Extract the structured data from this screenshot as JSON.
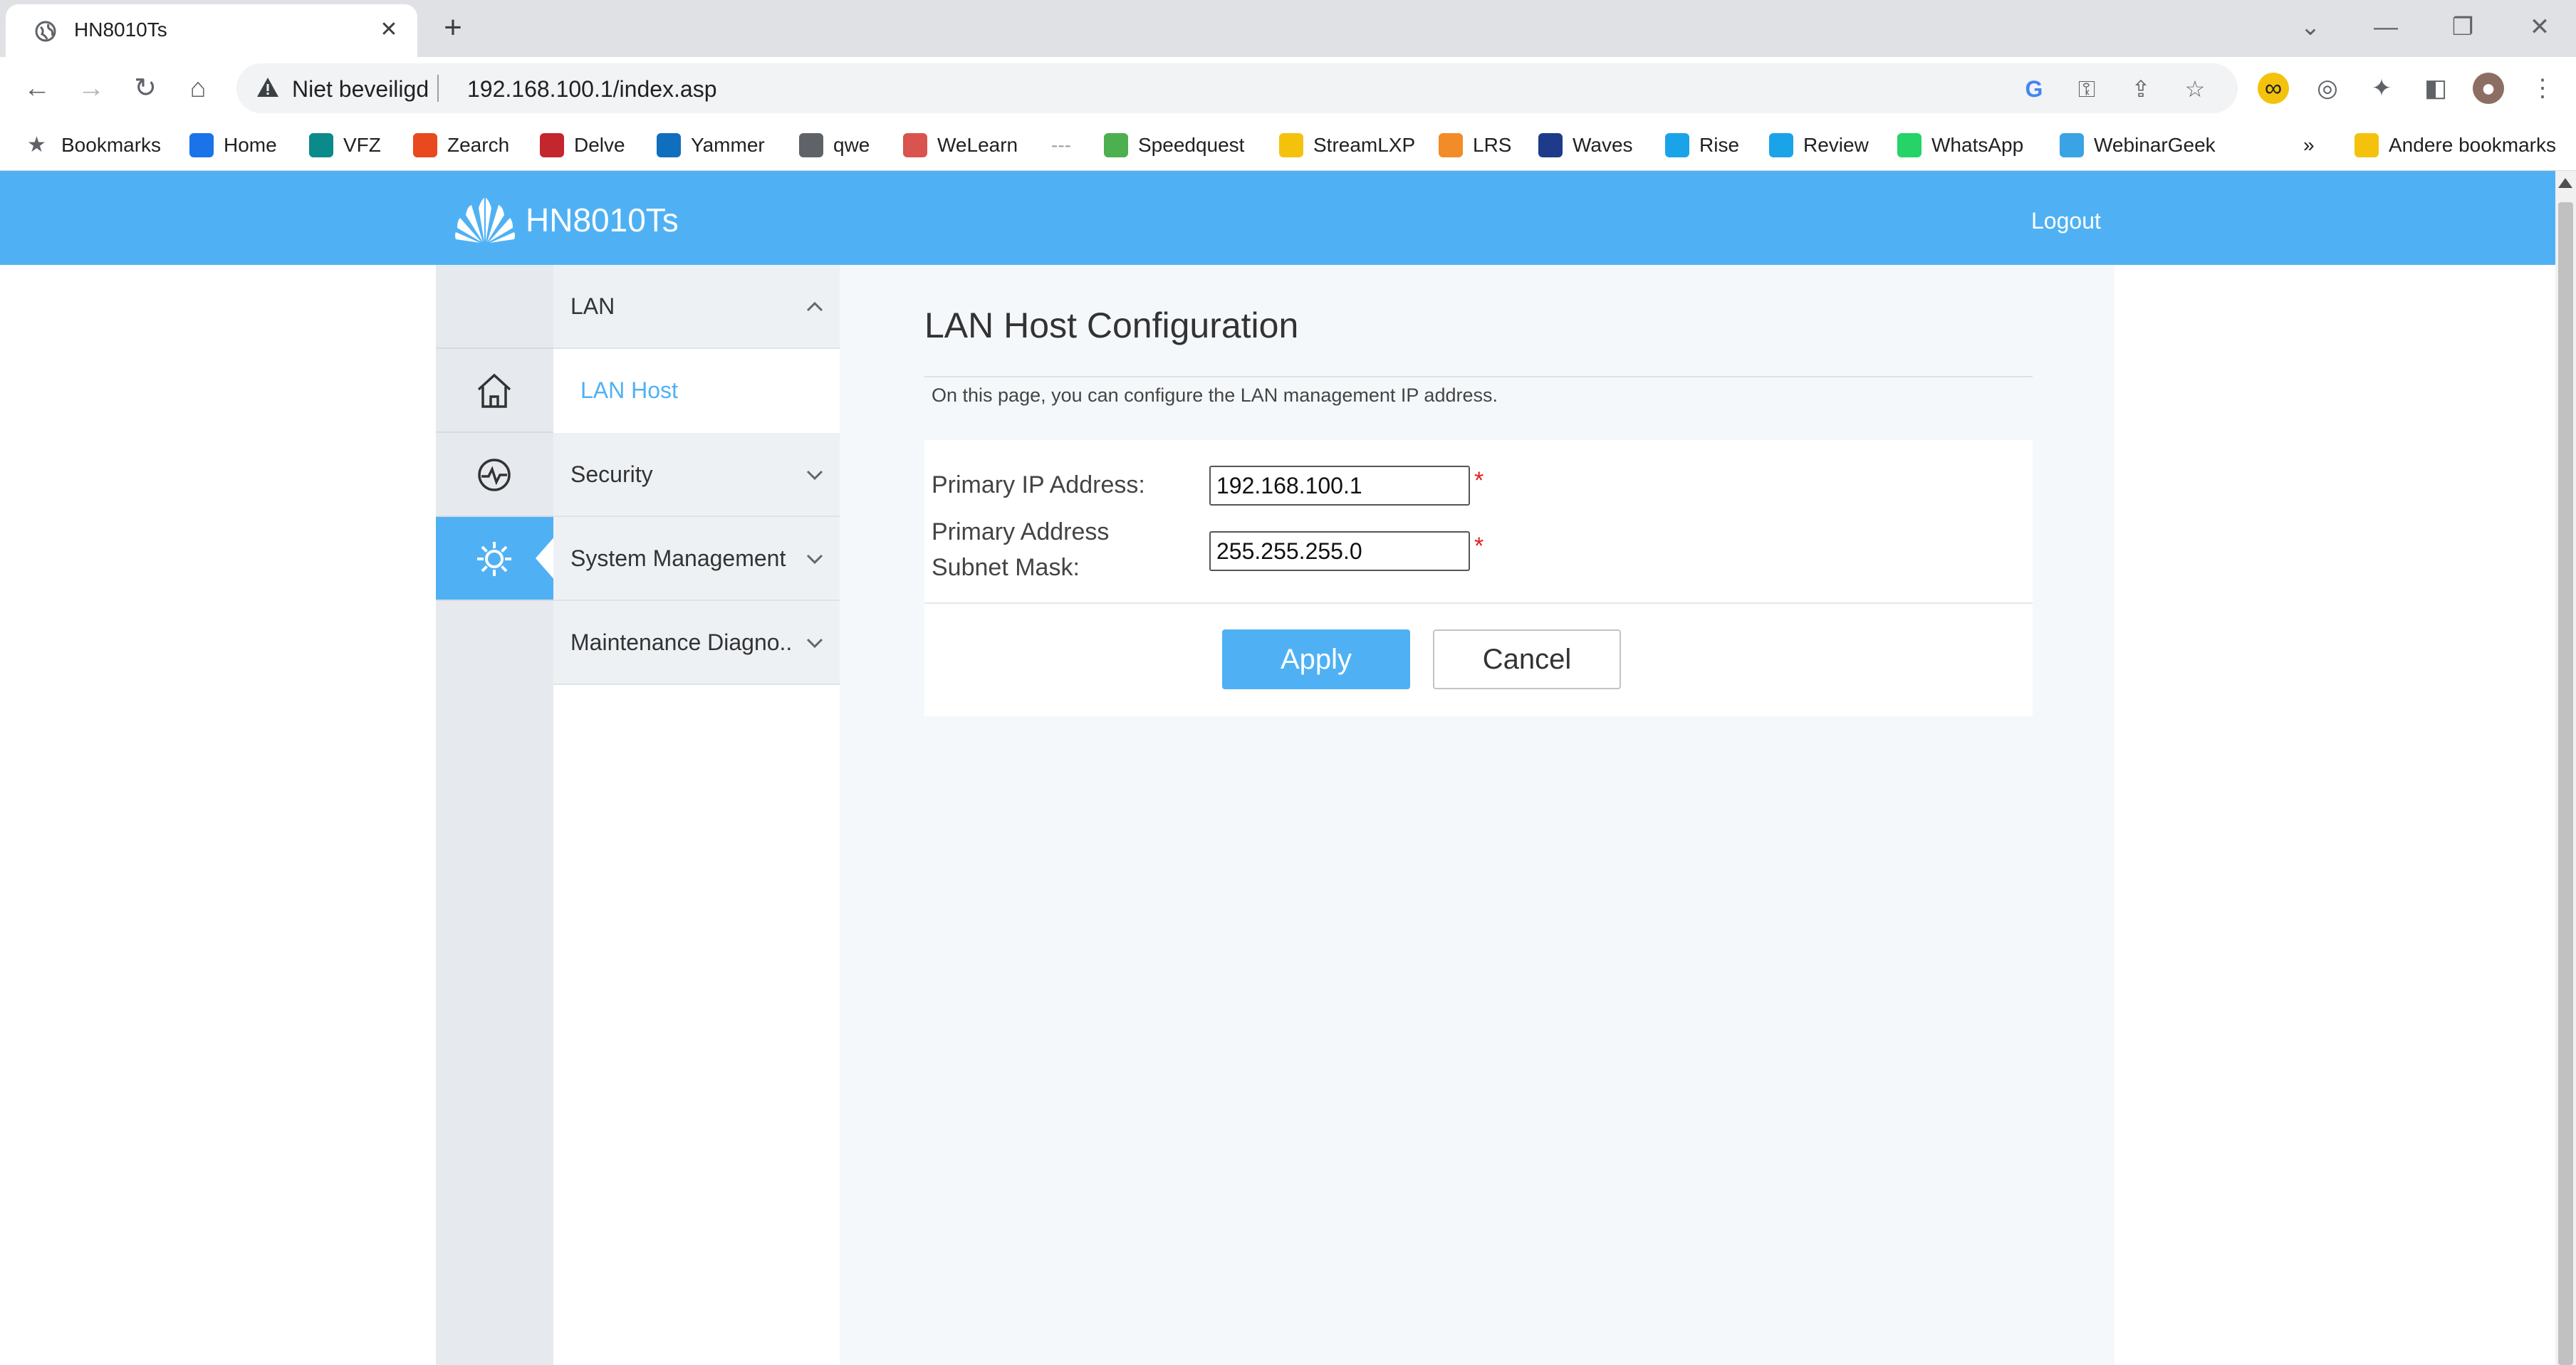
{
  "browser": {
    "tab_title": "HN8010Ts",
    "security_label": "Niet beveiligd",
    "url": "192.168.100.1/index.asp",
    "bookmarks": [
      {
        "label": "Bookmarks",
        "color": "#5f6368"
      },
      {
        "label": "Home",
        "color": "#1a73e8"
      },
      {
        "label": "VFZ",
        "color": "#0a8a8a"
      },
      {
        "label": "Zearch",
        "color": "#e8491d"
      },
      {
        "label": "Delve",
        "color": "#c4262e"
      },
      {
        "label": "Yammer",
        "color": "#106ebe"
      },
      {
        "label": "qwe",
        "color": "#5f6368"
      },
      {
        "label": "WeLearn",
        "color": "#d9534f"
      },
      {
        "label": "Speedquest",
        "color": "#4caf50"
      },
      {
        "label": "StreamLXP",
        "color": "#f4c20d"
      },
      {
        "label": "LRS",
        "color": "#f28c28"
      },
      {
        "label": "Waves",
        "color": "#1e3a8a"
      },
      {
        "label": "Rise",
        "color": "#1aa3e8"
      },
      {
        "label": "Review",
        "color": "#1aa3e8"
      },
      {
        "label": "WhatsApp",
        "color": "#25d366"
      },
      {
        "label": "WebinarGeek",
        "color": "#3aa3e3"
      }
    ],
    "overflow_label": "»",
    "other_bookmarks": "Andere bookmarks"
  },
  "header": {
    "brand": "HN8010Ts",
    "logout_label": "Logout"
  },
  "sidebar": {
    "icons": [
      "home-icon",
      "status-icon",
      "settings-icon"
    ],
    "menu": {
      "lan": "LAN",
      "lan_host": "LAN Host",
      "security": "Security",
      "system_management": "System Management",
      "maintenance": "Maintenance Diagno.."
    }
  },
  "content": {
    "title": "LAN Host Configuration",
    "description": "On this page, you can configure the LAN management IP address.",
    "form": {
      "primary_ip_label": "Primary IP Address:",
      "primary_ip_value": "192.168.100.1",
      "subnet_label_line1": "Primary Address",
      "subnet_label_line2": "Subnet Mask:",
      "subnet_value": "255.255.255.0",
      "required_mark": "*"
    },
    "apply_label": "Apply",
    "cancel_label": "Cancel"
  },
  "colors": {
    "accent": "#4fb1f4",
    "required": "#e02020"
  }
}
